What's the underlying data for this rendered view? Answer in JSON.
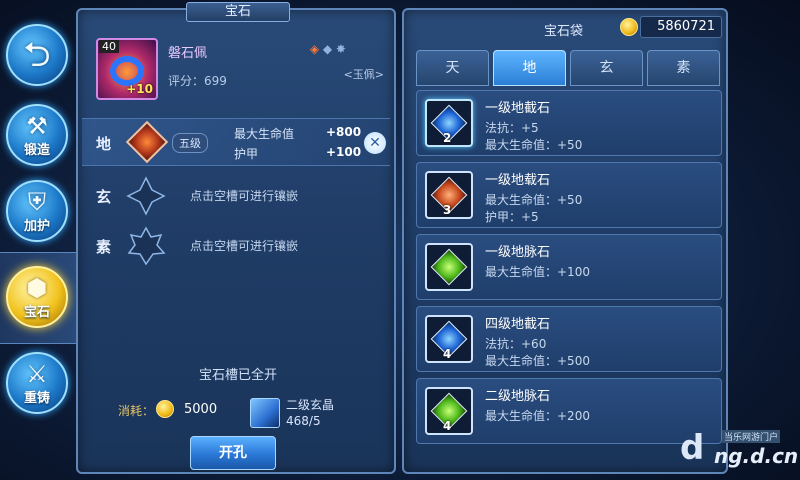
{
  "nav": {
    "items": [
      {
        "label": "",
        "icon": "back-arrow-icon"
      },
      {
        "label": "锻造",
        "icon": "forge-icon"
      },
      {
        "label": "加护",
        "icon": "guard-icon"
      },
      {
        "label": "宝石",
        "icon": "gem-icon"
      },
      {
        "label": "重铸",
        "icon": "recast-icon"
      }
    ]
  },
  "left": {
    "title": "宝石",
    "item": {
      "level": "40",
      "plus": "+10",
      "name": "磐石佩",
      "score": "评分：699",
      "set": "<玉佩>"
    },
    "slots": [
      {
        "label": "地",
        "grade": "五级",
        "stats": [
          {
            "name": "最大生命值",
            "value": "+800"
          },
          {
            "name": "护甲",
            "value": "+100"
          }
        ]
      },
      {
        "label": "玄",
        "hint": "点击空槽可进行镶嵌"
      },
      {
        "label": "素",
        "hint": "点击空槽可进行镶嵌"
      }
    ],
    "all_open": "宝石槽已全开",
    "cost_label": "消耗：",
    "cost_amount": "5000",
    "crystal_name": "二级玄晶",
    "crystal_count": "468/5",
    "open_button": "开孔"
  },
  "right": {
    "title": "宝石袋",
    "gold": "5860721",
    "tabs": [
      "天",
      "地",
      "玄",
      "素"
    ],
    "active_tab": "地",
    "gems": [
      {
        "name": "一级地截石",
        "count": "2",
        "color": "blue",
        "stats": [
          "法抗：+5",
          "最大生命值：+50"
        ]
      },
      {
        "name": "一级地载石",
        "count": "3",
        "color": "orange",
        "stats": [
          "最大生命值：+50",
          "护甲：+5"
        ]
      },
      {
        "name": "一级地脉石",
        "count": "",
        "color": "green",
        "stats": [
          "最大生命值：+100"
        ]
      },
      {
        "name": "四级地截石",
        "count": "4",
        "color": "blue",
        "stats": [
          "法抗：+60",
          "最大生命值：+500"
        ]
      },
      {
        "name": "二级地脉石",
        "count": "4",
        "color": "green",
        "stats": [
          "最大生命值：+200"
        ]
      }
    ]
  },
  "watermark": {
    "top": "当乐网游门户",
    "bottom": "ng.d.cn"
  }
}
